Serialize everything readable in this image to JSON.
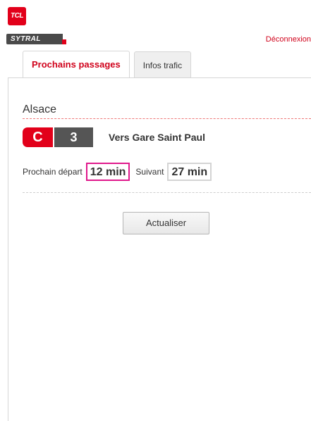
{
  "header": {
    "logo_tcl_text": "TCL",
    "logo_sytral_text": "SYTRAL",
    "logout_label": "Déconnexion"
  },
  "tabs": [
    {
      "label": "Prochains passages",
      "active": true
    },
    {
      "label": "Infos trafic",
      "active": false
    }
  ],
  "stop": {
    "name": "Alsace"
  },
  "line": {
    "mode": "C",
    "number": "3",
    "direction": "Vers Gare Saint Paul"
  },
  "times": {
    "next_label": "Prochain départ",
    "next_value": "12 min",
    "following_label": "Suivant",
    "following_value": "27 min"
  },
  "actions": {
    "refresh_label": "Actualiser"
  },
  "colors": {
    "brand_red": "#e2001a",
    "line_grey": "#555555",
    "highlight_pink": "#e0188c"
  }
}
